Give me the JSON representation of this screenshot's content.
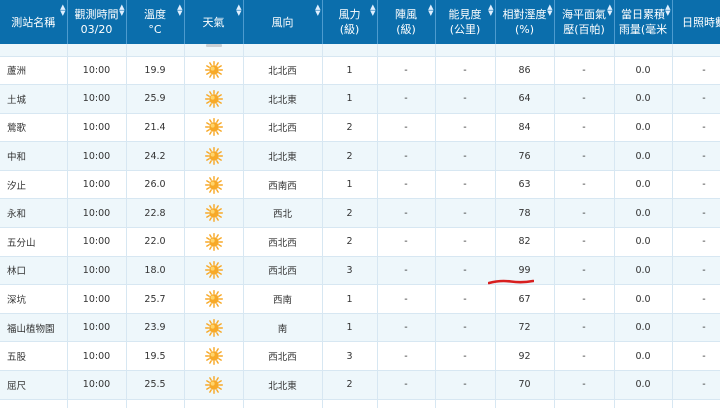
{
  "headers": [
    {
      "label": "測站名稱",
      "sort": true
    },
    {
      "label": "觀測時間\n03/20",
      "sort": true
    },
    {
      "label": "溫度\n°C",
      "sort": true
    },
    {
      "label": "天氣",
      "sort": true
    },
    {
      "label": "風向",
      "sort": true
    },
    {
      "label": "風力\n(級)",
      "sort": true
    },
    {
      "label": "陣風\n(級)",
      "sort": true
    },
    {
      "label": "能見度\n(公里)",
      "sort": true
    },
    {
      "label": "相對溼度\n(%)",
      "sort": true
    },
    {
      "label": "海平面氣\n壓(百帕)",
      "sort": true
    },
    {
      "label": "當日累積\n雨量(毫米",
      "sort": true
    },
    {
      "label": "日照時數",
      "sort": true
    }
  ],
  "weather_icon": "sunny-icon",
  "colors": {
    "header_bg": "#0b6eac",
    "row_alt_bg": "#eef7fb",
    "sun": "#f7a928",
    "annotation": "#d81f1f"
  },
  "rows": [
    {
      "station": "蘆洲",
      "time": "10:00",
      "temp": "19.9",
      "wind_dir": "北北西",
      "wind": "1",
      "gust": "-",
      "vis": "-",
      "hum": "86",
      "press": "-",
      "rain": "0.0",
      "sun": "-"
    },
    {
      "station": "土城",
      "time": "10:00",
      "temp": "25.9",
      "wind_dir": "北北東",
      "wind": "1",
      "gust": "-",
      "vis": "-",
      "hum": "64",
      "press": "-",
      "rain": "0.0",
      "sun": "-"
    },
    {
      "station": "鶯歌",
      "time": "10:00",
      "temp": "21.4",
      "wind_dir": "北北西",
      "wind": "2",
      "gust": "-",
      "vis": "-",
      "hum": "84",
      "press": "-",
      "rain": "0.0",
      "sun": "-"
    },
    {
      "station": "中和",
      "time": "10:00",
      "temp": "24.2",
      "wind_dir": "北北東",
      "wind": "2",
      "gust": "-",
      "vis": "-",
      "hum": "76",
      "press": "-",
      "rain": "0.0",
      "sun": "-"
    },
    {
      "station": "汐止",
      "time": "10:00",
      "temp": "26.0",
      "wind_dir": "西南西",
      "wind": "1",
      "gust": "-",
      "vis": "-",
      "hum": "63",
      "press": "-",
      "rain": "0.0",
      "sun": "-"
    },
    {
      "station": "永和",
      "time": "10:00",
      "temp": "22.8",
      "wind_dir": "西北",
      "wind": "2",
      "gust": "-",
      "vis": "-",
      "hum": "78",
      "press": "-",
      "rain": "0.0",
      "sun": "-"
    },
    {
      "station": "五分山",
      "time": "10:00",
      "temp": "22.0",
      "wind_dir": "西北西",
      "wind": "2",
      "gust": "-",
      "vis": "-",
      "hum": "82",
      "press": "-",
      "rain": "0.0",
      "sun": "-"
    },
    {
      "station": "林口",
      "time": "10:00",
      "temp": "18.0",
      "wind_dir": "西北西",
      "wind": "3",
      "gust": "-",
      "vis": "-",
      "hum": "99",
      "press": "-",
      "rain": "0.0",
      "sun": "-"
    },
    {
      "station": "深坑",
      "time": "10:00",
      "temp": "25.7",
      "wind_dir": "西南",
      "wind": "1",
      "gust": "-",
      "vis": "-",
      "hum": "67",
      "press": "-",
      "rain": "0.0",
      "sun": "-"
    },
    {
      "station": "福山植物園",
      "time": "10:00",
      "temp": "23.9",
      "wind_dir": "南",
      "wind": "1",
      "gust": "-",
      "vis": "-",
      "hum": "72",
      "press": "-",
      "rain": "0.0",
      "sun": "-"
    },
    {
      "station": "五股",
      "time": "10:00",
      "temp": "19.5",
      "wind_dir": "西北西",
      "wind": "3",
      "gust": "-",
      "vis": "-",
      "hum": "92",
      "press": "-",
      "rain": "0.0",
      "sun": "-"
    },
    {
      "station": "屈尺",
      "time": "10:00",
      "temp": "25.5",
      "wind_dir": "北北東",
      "wind": "2",
      "gust": "-",
      "vis": "-",
      "hum": "70",
      "press": "-",
      "rain": "0.0",
      "sun": "-"
    }
  ]
}
